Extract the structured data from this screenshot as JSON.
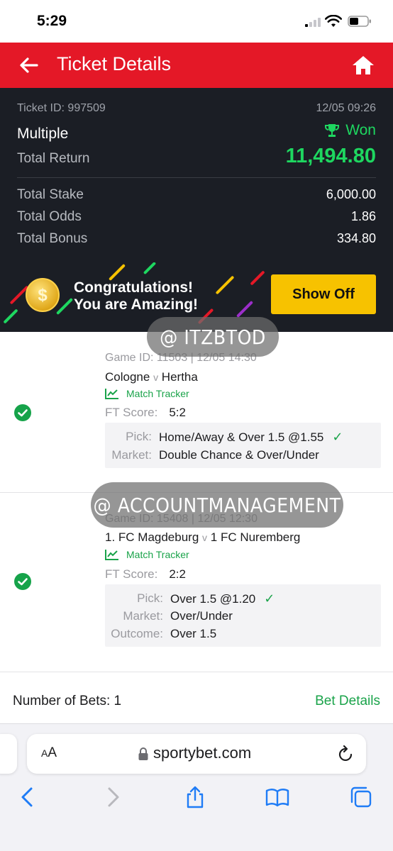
{
  "status_bar": {
    "time": "5:29"
  },
  "header": {
    "title": "Ticket Details"
  },
  "summary": {
    "ticket_id": "Ticket ID: 997509",
    "date": "12/05 09:26",
    "bet_type": "Multiple",
    "status": "Won",
    "total_return_label": "Total Return",
    "total_return_value": "11,494.80",
    "total_stake_label": "Total Stake",
    "total_stake_value": "6,000.00",
    "total_odds_label": "Total Odds",
    "total_odds_value": "1.86",
    "total_bonus_label": "Total Bonus",
    "total_bonus_value": "334.80"
  },
  "banner": {
    "line1": "Congratulations!",
    "line2": "You are Amazing!",
    "button": "Show Off",
    "coin_symbol": "$"
  },
  "bets": [
    {
      "game_id": "Game ID: 11503 | 12/05 14:30",
      "home": "Cologne",
      "vs": "v",
      "away": "Hertha",
      "tracker": "Match Tracker",
      "ft_label": "FT Score:",
      "ft_value": "5:2",
      "pick_label": "Pick:",
      "pick_value": "Home/Away & Over 1.5 @1.55",
      "market_label": "Market:",
      "market_value": "Double Chance & Over/Under"
    },
    {
      "game_id": "Game ID: 15408 | 12/05 12:30",
      "home": "1. FC Magdeburg",
      "vs": "v",
      "away": "1 FC Nuremberg",
      "tracker": "Match Tracker",
      "ft_label": "FT Score:",
      "ft_value": "2:2",
      "pick_label": "Pick:",
      "pick_value": "Over 1.5 @1.20",
      "market_label": "Market:",
      "market_value": "Over/Under",
      "outcome_label": "Outcome:",
      "outcome_value": "Over 1.5"
    }
  ],
  "watermarks": [
    "@ ITZBTOD",
    "@ ACCOUNTMANAGEMENT"
  ],
  "footer": {
    "num_bets": "Number of Bets: 1",
    "bet_details": "Bet Details"
  },
  "browser": {
    "aa_large": "A",
    "aa_small": "A",
    "domain": "sportybet.com"
  },
  "colors": {
    "brand_red": "#e41827",
    "won_green": "#1ed760",
    "accent_green": "#1aa34a",
    "button_yellow": "#f7c200",
    "panel_dark": "#1b1e25"
  },
  "icons": [
    "back-arrow-icon",
    "home-icon",
    "trophy-icon",
    "chart-icon",
    "check-circle-icon",
    "checkmark-icon",
    "lock-icon",
    "reload-icon",
    "chevron-left-icon",
    "chevron-right-icon",
    "share-icon",
    "book-icon",
    "tabs-icon"
  ]
}
